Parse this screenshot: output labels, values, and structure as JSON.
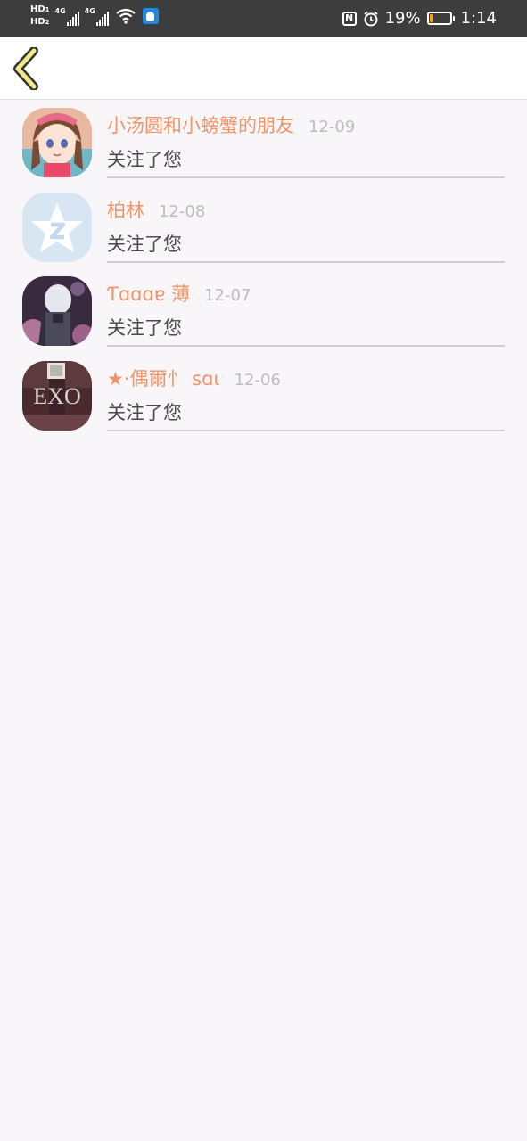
{
  "status_bar": {
    "hd_top": "HD",
    "hd_top_sub": "1",
    "hd_bottom": "HD",
    "hd_bottom_sub": "2",
    "net1": "4G",
    "net2": "4G",
    "battery_percent_text": "19%",
    "battery_level": 0.19,
    "time": "1:14"
  },
  "colors": {
    "name": "#f0956a",
    "date": "#bdbdbd",
    "back_icon": "#f3e98a"
  },
  "notifications": [
    {
      "name": "小汤圆和小螃蟹的朋友",
      "date": "12-09",
      "action": "关注了您"
    },
    {
      "name": "柏林",
      "date": "12-08",
      "action": "关注了您"
    },
    {
      "name": "Ƭɑɑɑɐ 薄",
      "date": "12-07",
      "action": "关注了您"
    },
    {
      "name": "★·偶爾忄 sɑι",
      "date": "12-06",
      "action": "关注了您"
    }
  ],
  "avatar_texts": {
    "exo": "EXO"
  }
}
